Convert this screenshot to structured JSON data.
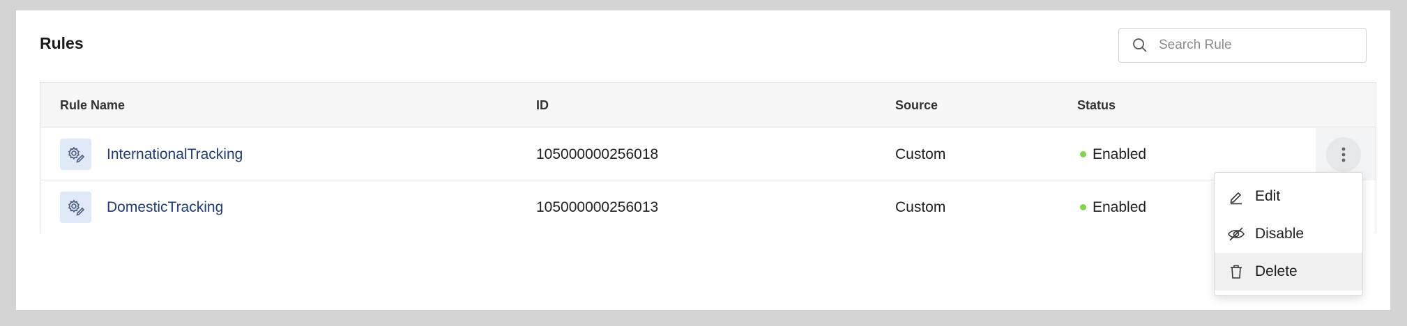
{
  "page": {
    "title": "Rules"
  },
  "search": {
    "placeholder": "Search Rule"
  },
  "table": {
    "headers": {
      "name": "Rule Name",
      "id": "ID",
      "source": "Source",
      "status": "Status"
    },
    "rows": [
      {
        "name": "InternationalTracking",
        "id": "105000000256018",
        "source": "Custom",
        "status": "Enabled"
      },
      {
        "name": "DomesticTracking",
        "id": "105000000256013",
        "source": "Custom",
        "status": "Enabled"
      }
    ]
  },
  "menu": {
    "items": [
      {
        "label": "Edit",
        "icon": "edit-pencil-icon"
      },
      {
        "label": "Disable",
        "icon": "eye-slash-icon"
      },
      {
        "label": "Delete",
        "icon": "trash-icon"
      }
    ]
  },
  "colors": {
    "link": "#1e3a7a",
    "status_enabled": "#7fd54a",
    "rule_icon_bg": "#dfe8f6"
  }
}
